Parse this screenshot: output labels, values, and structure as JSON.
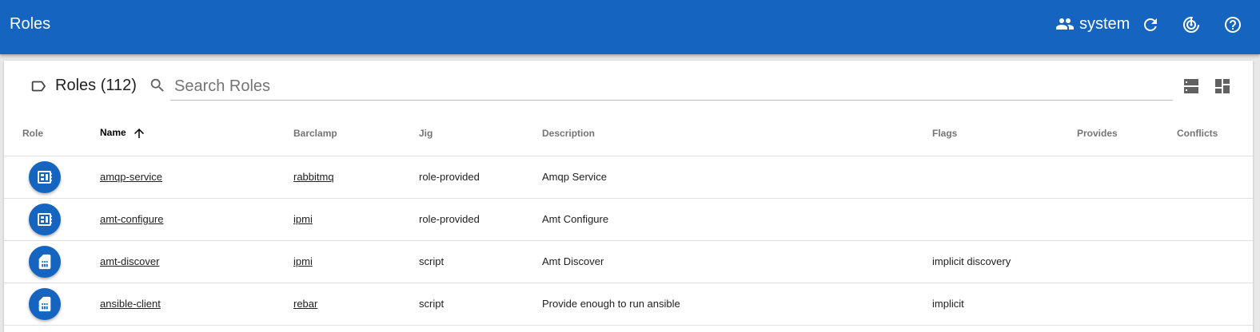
{
  "appbar": {
    "title": "Roles",
    "user": "system",
    "icons": [
      "people-icon",
      "refresh-icon",
      "radar-icon",
      "help-icon"
    ]
  },
  "toolbar": {
    "heading": "Roles (112)",
    "search_placeholder": "Search Roles",
    "search_value": ""
  },
  "table": {
    "headers": {
      "role": "Role",
      "name": "Name",
      "barclamp": "Barclamp",
      "jig": "Jig",
      "description": "Description",
      "flags": "Flags",
      "provides": "Provides",
      "conflicts": "Conflicts"
    },
    "sort": {
      "column": "Name",
      "direction": "ascending"
    },
    "rows": [
      {
        "icon": "chip-icon",
        "name": "amqp-service",
        "barclamp": "rabbitmq",
        "jig": "role-provided",
        "description": "Amqp Service",
        "flags": "",
        "provides": "",
        "conflicts": ""
      },
      {
        "icon": "chip-icon",
        "name": "amt-configure",
        "barclamp": "ipmi",
        "jig": "role-provided",
        "description": "Amt Configure",
        "flags": "",
        "provides": "",
        "conflicts": ""
      },
      {
        "icon": "sim-card-icon",
        "name": "amt-discover",
        "barclamp": "ipmi",
        "jig": "script",
        "description": "Amt Discover",
        "flags": "implicit discovery",
        "provides": "",
        "conflicts": ""
      },
      {
        "icon": "sim-card-icon",
        "name": "ansible-client",
        "barclamp": "rebar",
        "jig": "script",
        "description": "Provide enough to run ansible",
        "flags": "implicit",
        "provides": "",
        "conflicts": ""
      }
    ]
  },
  "colors": {
    "primary": "#1565c0",
    "text": "#212121",
    "header_text": "#757575"
  }
}
